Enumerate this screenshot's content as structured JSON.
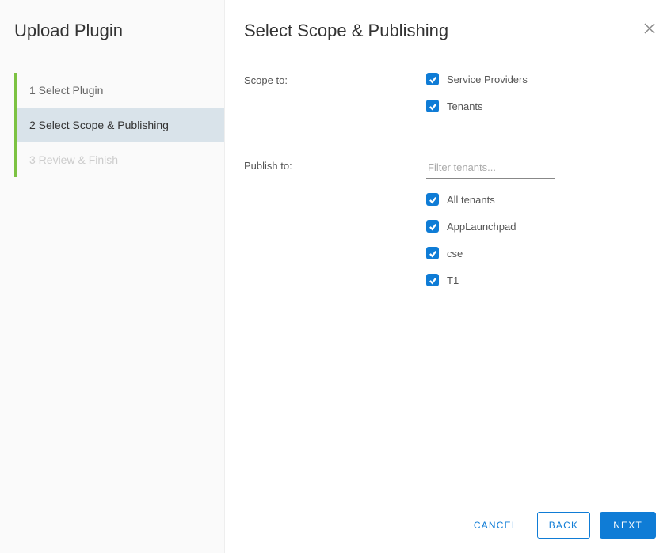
{
  "sidebar": {
    "title": "Upload Plugin",
    "steps": [
      {
        "label": "1  Select Plugin"
      },
      {
        "label": "2  Select Scope & Publishing"
      },
      {
        "label": "3  Review & Finish"
      }
    ]
  },
  "main": {
    "title": "Select Scope & Publishing"
  },
  "form": {
    "scopeLabel": "Scope to:",
    "publishLabel": "Publish to:",
    "filterPlaceholder": "Filter tenants...",
    "scopeItems": [
      {
        "label": "Service Providers"
      },
      {
        "label": "Tenants"
      }
    ],
    "publishItems": [
      {
        "label": "All tenants"
      },
      {
        "label": "AppLaunchpad"
      },
      {
        "label": "cse"
      },
      {
        "label": "T1"
      }
    ]
  },
  "footer": {
    "cancel": "CANCEL",
    "back": "BACK",
    "next": "NEXT"
  }
}
